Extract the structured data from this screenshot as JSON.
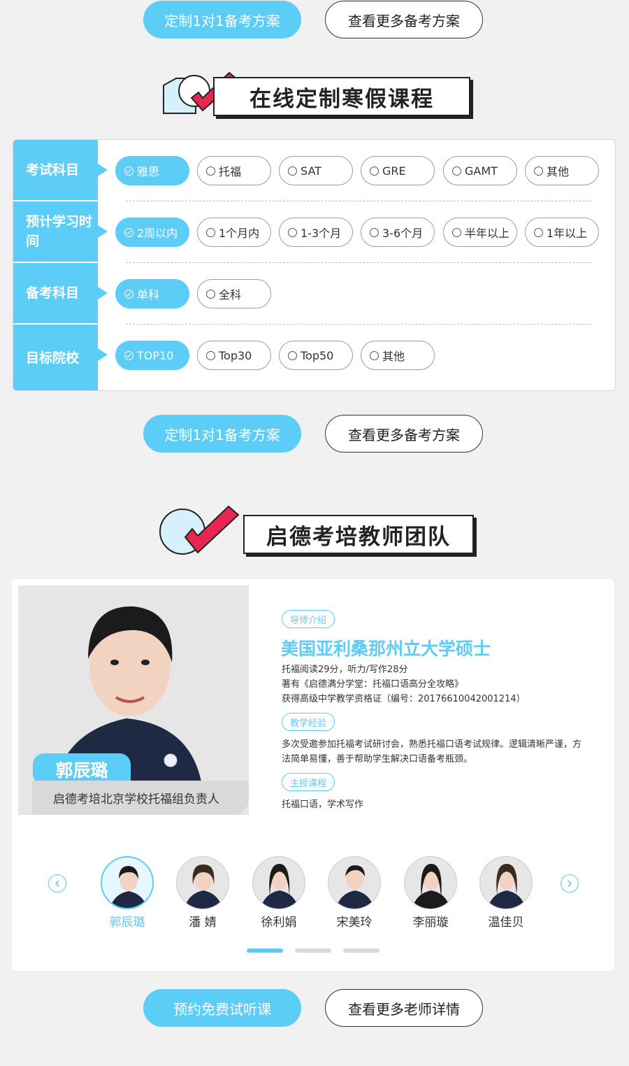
{
  "top_buttons": {
    "primary": "定制1对1备考方案",
    "secondary": "查看更多备考方案"
  },
  "section1": {
    "title": "在线定制寒假课程"
  },
  "form": {
    "rows": [
      {
        "label": "考试科目",
        "options": [
          "雅思",
          "托福",
          "SAT",
          "GRE",
          "GAMT",
          "其他"
        ],
        "selected": "雅思"
      },
      {
        "label": "预计学习时间",
        "options": [
          "2周以内",
          "1个月内",
          "1-3个月",
          "3-6个月",
          "半年以上",
          "1年以上"
        ],
        "selected": "2周以内"
      },
      {
        "label": "备考科目",
        "options": [
          "单科",
          "全科"
        ],
        "selected": "单科"
      },
      {
        "label": "目标院校",
        "options": [
          "TOP10",
          "Top30",
          "Top50",
          "其他"
        ],
        "selected": "TOP10"
      }
    ]
  },
  "mid_buttons": {
    "primary": "定制1对1备考方案",
    "secondary": "查看更多备考方案"
  },
  "section2": {
    "title": "启德考培教师团队"
  },
  "teacher": {
    "name": "郭辰璐",
    "role": "启德考培北京学校托福组负责人",
    "tag_intro": "导师介绍",
    "headline": "美国亚利桑那州立大学硕士",
    "intro_lines": [
      "托福阅读29分，听力/写作28分",
      "著有《启德满分学堂：托福口语高分全攻略》",
      "获得高级中学教学资格证（编号：20176610042001214）"
    ],
    "tag_experience": "教学经验",
    "experience": "多次受邀参加托福考试研讨会，熟悉托福口语考试规律。逻辑清晰严谨，方法简单易懂，善于帮助学生解决口语备考瓶颈。",
    "tag_courses": "主授课程",
    "courses": "托福口语，学术写作"
  },
  "carousel": {
    "teachers": [
      "郭辰璐",
      "潘 婧",
      "徐利娟",
      "宋美玲",
      "李丽璇",
      "温佳贝"
    ],
    "active_index": 0,
    "page_count": 3,
    "active_page": 0
  },
  "bottom_buttons": {
    "primary": "预约免费试听课",
    "secondary": "查看更多老师详情"
  },
  "colors": {
    "accent": "#5ccdf6",
    "dark": "#222222",
    "check_red": "#e8264f"
  }
}
